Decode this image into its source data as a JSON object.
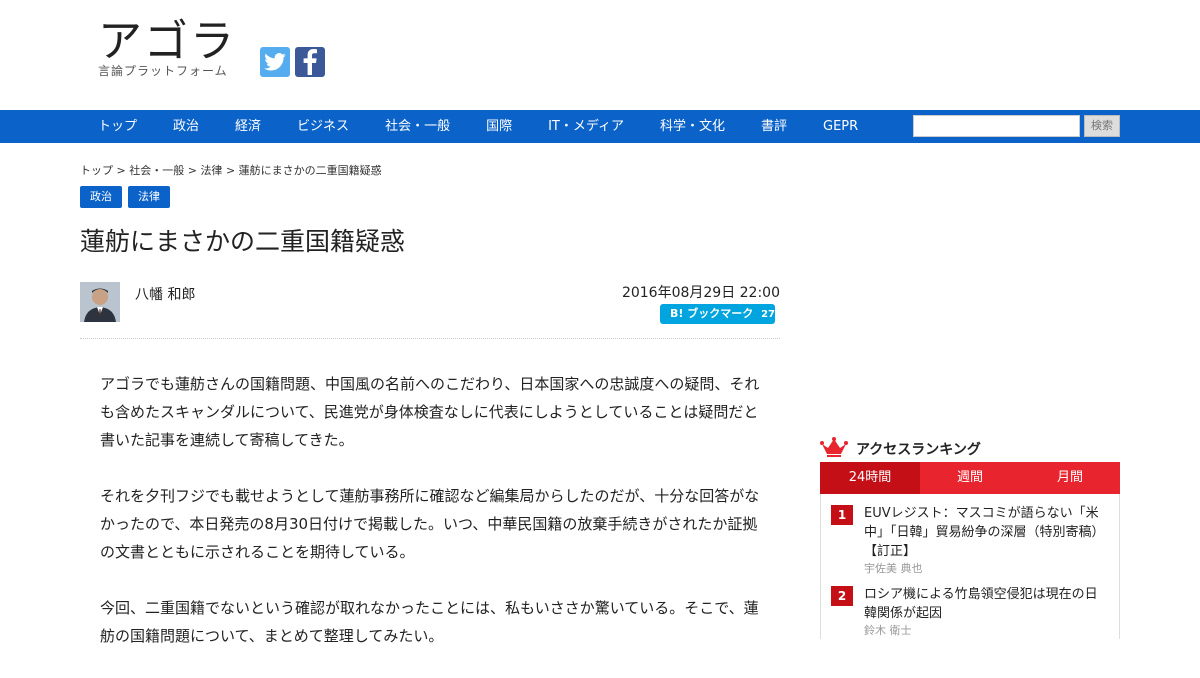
{
  "header": {
    "logo_main": "アゴラ",
    "logo_sub": "言論プラットフォーム"
  },
  "nav": {
    "items": [
      "トップ",
      "政治",
      "経済",
      "ビジネス",
      "社会・一般",
      "国際",
      "IT・メディア",
      "科学・文化",
      "書評",
      "GEPR"
    ],
    "search_value": "",
    "search_button": "検索"
  },
  "breadcrumb": {
    "items": [
      "トップ",
      "社会・一般",
      "法律",
      "蓮舫にまさかの二重国籍疑惑"
    ],
    "separator": ">"
  },
  "tags": [
    "政治",
    "法律"
  ],
  "article": {
    "title": "蓮舫にまさかの二重国籍疑惑",
    "author": "八幡 和郎",
    "date": "2016年08月29日 22:00",
    "hatena_label": "ブックマーク",
    "hatena_count": "27",
    "paragraphs": [
      "アゴラでも蓮舫さんの国籍問題、中国風の名前へのこだわり、日本国家への忠誠度への疑問、それも含めたスキャンダルについて、民進党が身体検査なしに代表にしようとしていることは疑問だと書いた記事を連続して寄稿してきた。",
      "それを夕刊フジでも載せようとして蓮舫事務所に確認など編集局からしたのだが、十分な回答がなかったので、本日発売の8月30日付けで掲載した。いつ、中華民国籍の放棄手続きがされたか証拠の文書とともに示されることを期待している。",
      "今回、二重国籍でないという確認が取れなかったことには、私もいささか驚いている。そこで、蓮舫の国籍問題について、まとめて整理してみたい。"
    ]
  },
  "ranking": {
    "title": "アクセスランキング",
    "tabs": [
      "24時間",
      "週間",
      "月間"
    ],
    "active_tab": 0,
    "items": [
      {
        "rank": "1",
        "title": "EUVレジスト：マスコミが語らない「米中」「日韓」貿易紛争の深層（特別寄稿）【訂正】",
        "author": "宇佐美 典也"
      },
      {
        "rank": "2",
        "title": "ロシア機による竹島領空侵犯は現在の日韓関係が起因",
        "author": "鈴木 衛士"
      }
    ]
  },
  "colors": {
    "nav_bg": "#0b62c9",
    "ranking_red": "#e8242e",
    "ranking_dark_red": "#c40f17",
    "hatena_blue": "#00a4de",
    "twitter": "#55acee",
    "facebook": "#3b5998"
  },
  "icons": [
    "twitter-icon",
    "facebook-icon",
    "crown-icon",
    "hatena-icon",
    "author-avatar"
  ]
}
